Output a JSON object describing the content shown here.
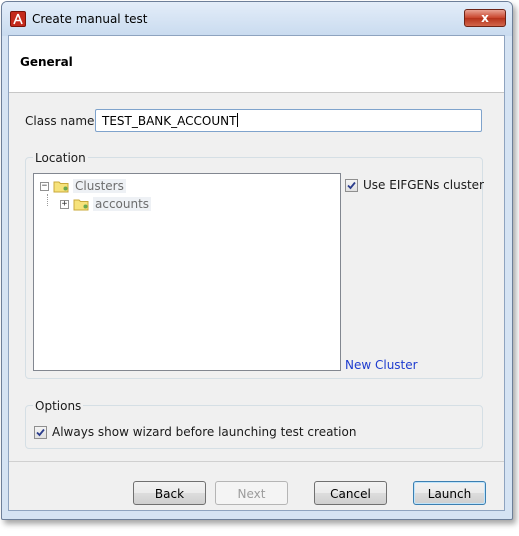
{
  "window": {
    "title": "Create manual test",
    "close_label": "x"
  },
  "header": {
    "title": "General"
  },
  "class_name": {
    "label": "Class name:",
    "value": "TEST_BANK_ACCOUNT"
  },
  "location": {
    "label": "Location",
    "tree": [
      {
        "label": "Clusters",
        "expander": "−",
        "icon": "folder-icon"
      },
      {
        "label": "accounts",
        "expander": "+",
        "icon": "folder-icon"
      }
    ],
    "use_eifgens_label": "Use EIFGENs cluster",
    "use_eifgens_checked": true,
    "new_cluster_label": "New Cluster"
  },
  "options": {
    "label": "Options",
    "always_show_label": "Always show wizard before launching test creation",
    "always_show_checked": true
  },
  "buttons": {
    "back": "Back",
    "next": "Next",
    "cancel": "Cancel",
    "launch": "Launch"
  },
  "colors": {
    "link": "#1e3ccf",
    "window_frame": "#d5e3f3",
    "app_icon": "#c42a1c"
  }
}
